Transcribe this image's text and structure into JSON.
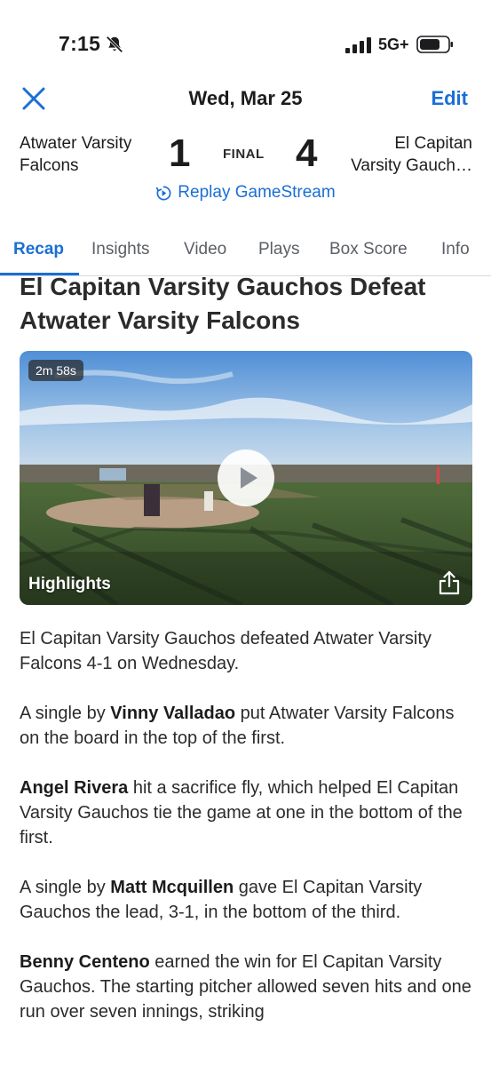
{
  "status": {
    "time": "7:15",
    "network": "5G+",
    "icons": [
      "bell-off-icon",
      "signal-icon",
      "battery-icon"
    ]
  },
  "header": {
    "close_icon": "close-icon",
    "date": "Wed, Mar 25",
    "edit_label": "Edit"
  },
  "scoreboard": {
    "away_team_line1": "Atwater Varsity",
    "away_team_line2": "Falcons",
    "away_score": "1",
    "status": "FINAL",
    "home_score": "4",
    "home_team_line1": "El Capitan",
    "home_team_line2": "Varsity Gauch…",
    "replay_label": "Replay GameStream"
  },
  "tabs": [
    {
      "label": "Recap",
      "active": true
    },
    {
      "label": "Insights",
      "active": false
    },
    {
      "label": "Video",
      "active": false
    },
    {
      "label": "Plays",
      "active": false
    },
    {
      "label": "Box Score",
      "active": false
    },
    {
      "label": "Info",
      "active": false
    }
  ],
  "article": {
    "headline": "El Capitan Varsity Gauchos Defeat Atwater Varsity Falcons",
    "video": {
      "duration": "2m 58s",
      "label": "Highlights"
    },
    "paragraphs": [
      {
        "bold": "",
        "text": "El Capitan Varsity Gauchos defeated Atwater Varsity Falcons 4-1 on Wednesday."
      },
      {
        "lead": "A single by ",
        "bold": "Vinny Valladao",
        "text": " put Atwater Varsity Falcons on the board in the top of the first."
      },
      {
        "lead": "",
        "bold": "Angel Rivera",
        "text": " hit a sacrifice fly, which helped El Capitan Varsity Gauchos tie the game at one in the bottom of the first."
      },
      {
        "lead": "A single by ",
        "bold": "Matt Mcquillen",
        "text": " gave El Capitan Varsity Gauchos the lead, 3-1, in the bottom of the third."
      },
      {
        "lead": "",
        "bold": "Benny Centeno",
        "text": " earned the win for El Capitan Varsity Gauchos. The starting pitcher allowed seven hits and one run over seven innings, striking"
      }
    ]
  },
  "colors": {
    "accent": "#1a6fd4",
    "text": "#1c1c1e"
  }
}
